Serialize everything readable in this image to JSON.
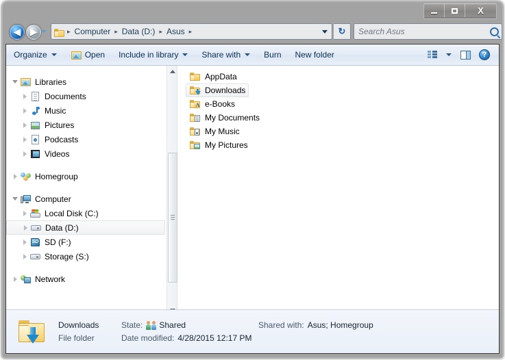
{
  "window": {
    "title": "",
    "controls": {
      "minimize": "–",
      "maximize": "□",
      "close": "X"
    }
  },
  "addressbar": {
    "back_label": "◀",
    "forward_label": "▶",
    "history_label": "▼",
    "folder_icon": "folder-icon",
    "separator": "▸",
    "crumbs": [
      "Computer",
      "Data (D:)",
      "Asus"
    ],
    "refresh_label": "↻",
    "search": {
      "placeholder": "Search Asus",
      "value": "",
      "icon": "search-icon"
    }
  },
  "toolbar": {
    "items": [
      {
        "label": "Organize",
        "has_caret": true,
        "icon": null
      },
      {
        "label": "Open",
        "has_caret": false,
        "icon": "open-folder-icon"
      },
      {
        "label": "Include in library",
        "has_caret": true,
        "icon": null
      },
      {
        "label": "Share with",
        "has_caret": true,
        "icon": null
      },
      {
        "label": "Burn",
        "has_caret": false,
        "icon": null
      },
      {
        "label": "New folder",
        "has_caret": false,
        "icon": null
      }
    ],
    "view_button": {
      "name": "change-view-button",
      "caret": true
    },
    "preview_button": {
      "name": "show-preview-pane-button"
    },
    "help_button": {
      "name": "help-button",
      "glyph": "?"
    }
  },
  "navpane": {
    "groups": [
      {
        "header": {
          "label": "Libraries",
          "icon": "library-icon",
          "expanded": true
        },
        "items": [
          {
            "label": "Documents",
            "icon": "document-icon"
          },
          {
            "label": "Music",
            "icon": "music-icon"
          },
          {
            "label": "Pictures",
            "icon": "picture-icon"
          },
          {
            "label": "Podcasts",
            "icon": "podcast-icon"
          },
          {
            "label": "Videos",
            "icon": "video-icon"
          }
        ]
      },
      {
        "header": {
          "label": "Homegroup",
          "icon": "homegroup-icon",
          "expanded": false
        },
        "items": []
      },
      {
        "header": {
          "label": "Computer",
          "icon": "computer-icon",
          "expanded": true
        },
        "items": [
          {
            "label": "Local Disk (C:)",
            "icon": "os-drive-icon",
            "selected": false
          },
          {
            "label": "Data (D:)",
            "icon": "drive-icon",
            "selected": true
          },
          {
            "label": "SD (F:)",
            "icon": "sd-card-icon",
            "selected": false
          },
          {
            "label": "Storage (S:)",
            "icon": "drive-icon",
            "selected": false
          }
        ]
      },
      {
        "header": {
          "label": "Network",
          "icon": "network-icon",
          "expanded": false
        },
        "items": []
      }
    ],
    "scrollbar": {
      "up_arrow": "▲",
      "down_arrow": "▼"
    }
  },
  "filelist": {
    "items": [
      {
        "label": "AppData",
        "icon": "folder-icon",
        "selected": false
      },
      {
        "label": "Downloads",
        "icon": "downloads-folder-icon",
        "selected": true
      },
      {
        "label": "e-Books",
        "icon": "ebooks-folder-icon",
        "selected": false
      },
      {
        "label": "My Documents",
        "icon": "documents-folder-icon",
        "selected": false
      },
      {
        "label": "My Music",
        "icon": "music-folder-icon",
        "selected": false
      },
      {
        "label": "My Pictures",
        "icon": "pictures-folder-icon",
        "selected": false
      }
    ]
  },
  "details": {
    "icon": "downloads-folder-large-icon",
    "name": "Downloads",
    "type": "File folder",
    "state_label": "State:",
    "state_value": "Shared",
    "state_icon": "shared-users-icon",
    "date_label": "Date modified:",
    "date_value": "4/28/2015 12:17 PM",
    "shared_with_label": "Shared with:",
    "shared_with_value": "Asus; Homegroup"
  },
  "colors": {
    "accent": "#2f6fae",
    "toolbar_bg": "#e4ecf6",
    "details_bg": "#eaf0f9",
    "folder_yellow": "#f3c95f",
    "selection_border": "#dfe2e5"
  }
}
